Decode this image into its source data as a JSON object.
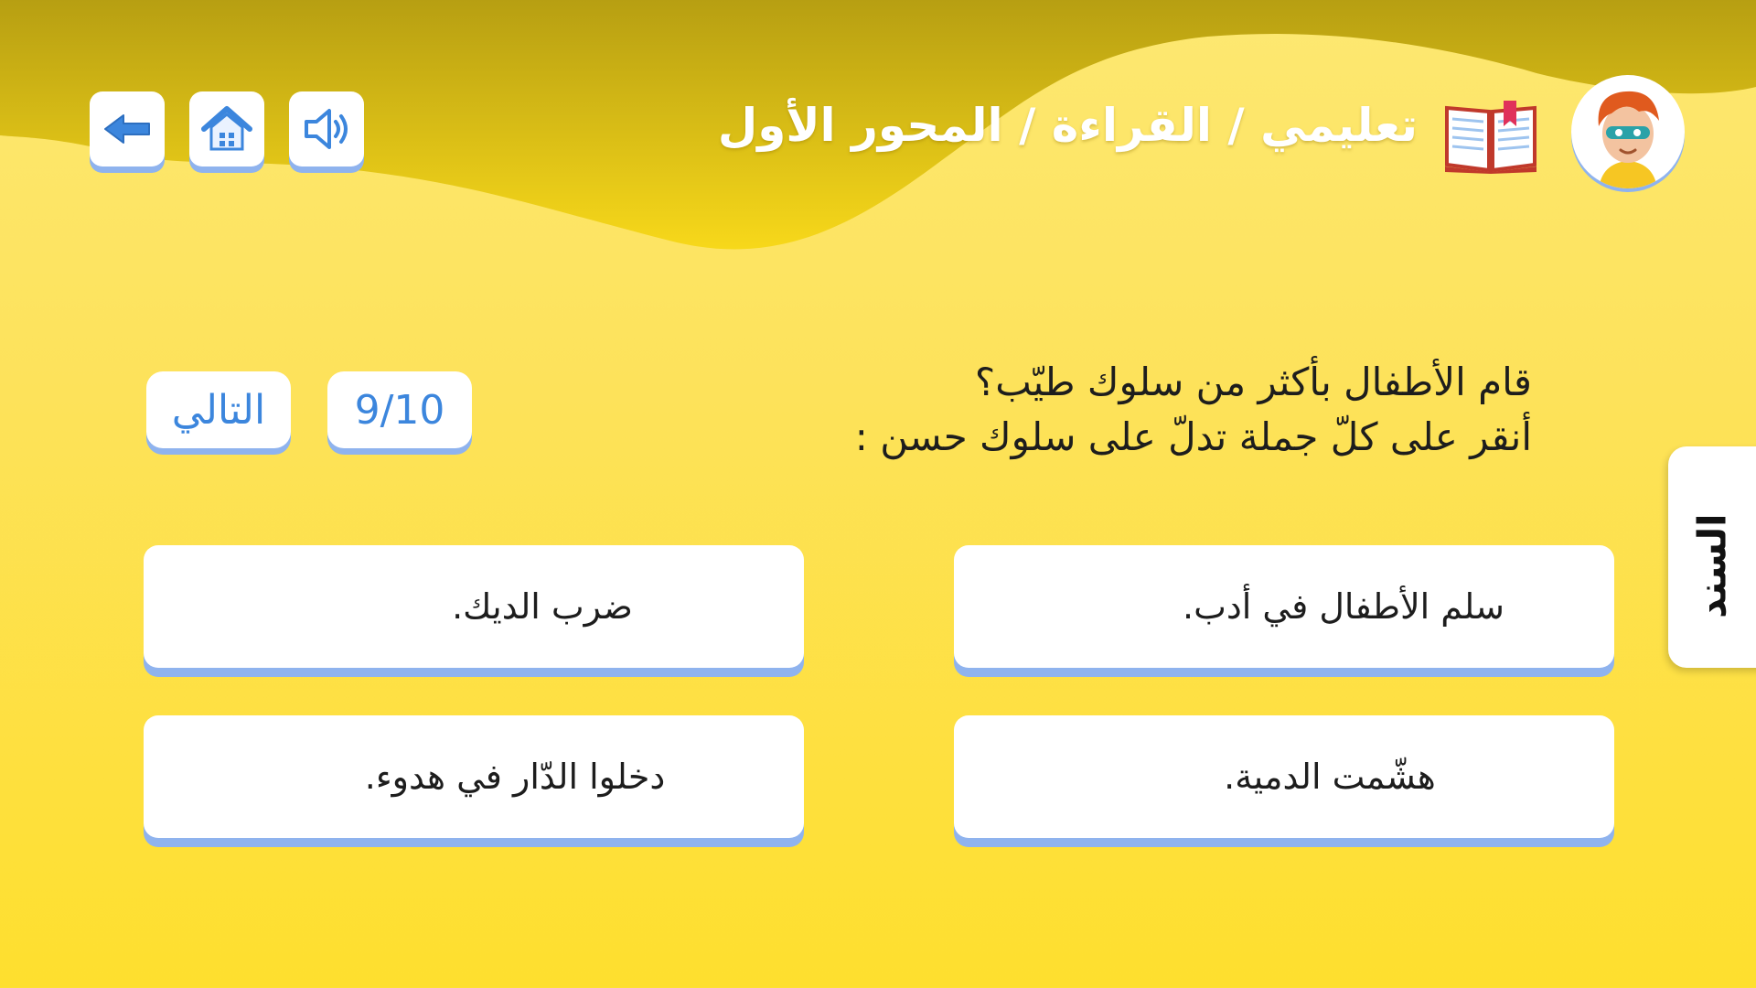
{
  "header": {
    "title": "تعليمي / القراءة / المحور الأول",
    "icons": {
      "back": "arrow-left-icon",
      "home": "house-icon",
      "sound": "speaker-icon",
      "book": "open-book-icon",
      "avatar": "character-avatar"
    }
  },
  "colors": {
    "background": "#fedf2e",
    "button_text": "#3c86dd",
    "button_shadow": "#8fb3ee",
    "text": "#1d1d1d"
  },
  "controls": {
    "next_label": "التالي",
    "progress": "9/10"
  },
  "question": {
    "line1": "قام الأطفال بأكثر من سلوك طيّب؟",
    "line2": "أنقر على كلّ جملة تدلّ على سلوك حسن :"
  },
  "choices": [
    "سلم الأطفال في أدب.",
    "ضرب الديك.",
    "هشّمت الدمية.",
    "دخلوا الدّار في هدوء."
  ],
  "side_tab": {
    "label": "السند"
  }
}
